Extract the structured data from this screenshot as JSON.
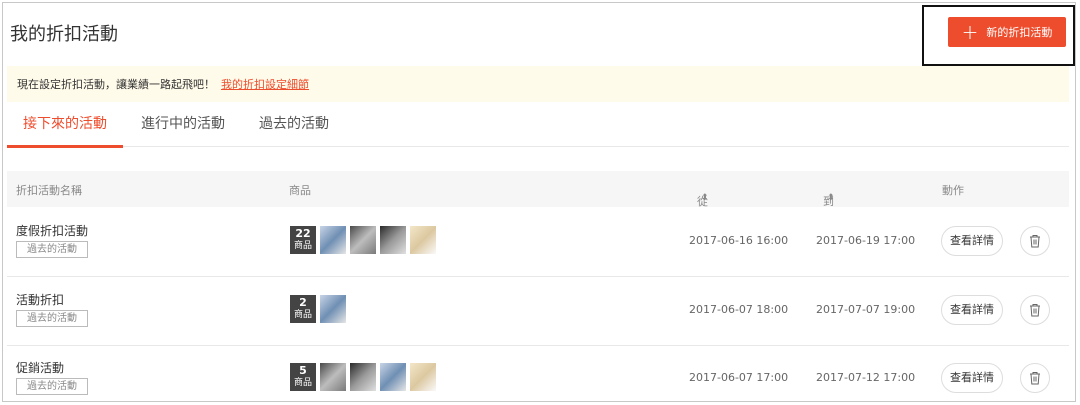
{
  "header": {
    "title": "我的折扣活動",
    "new_button_label": "新的折扣活動",
    "new_button_icon": "plus-icon",
    "accent_color": "#ee4d2d"
  },
  "notice": {
    "text": "現在設定折扣活動，讓業績一路起飛吧！",
    "link_text": "我的折扣設定細節"
  },
  "tabs": [
    {
      "label": "接下來的活動",
      "active": true
    },
    {
      "label": "進行中的活動",
      "active": false
    },
    {
      "label": "過去的活動",
      "active": false
    }
  ],
  "table": {
    "columns": {
      "name": "折扣活動名稱",
      "products": "商品",
      "from": "從",
      "to": "到",
      "action": "動作"
    },
    "sort_icon": "sort-icon",
    "rows": [
      {
        "name": "度假折扣活動",
        "status": "過去的活動",
        "product_count": "22",
        "product_unit": "商品",
        "from": "2017-06-16 16:00",
        "to": "2017-06-19 17:00",
        "detail_label": "查看詳情"
      },
      {
        "name": "活動折扣",
        "status": "過去的活動",
        "product_count": "2",
        "product_unit": "商品",
        "from": "2017-06-07 18:00",
        "to": "2017-07-07 19:00",
        "detail_label": "查看詳情"
      },
      {
        "name": "促銷活動",
        "status": "過去的活動",
        "product_count": "5",
        "product_unit": "商品",
        "from": "2017-06-07 17:00",
        "to": "2017-07-12 17:00",
        "detail_label": "查看詳情"
      }
    ]
  }
}
